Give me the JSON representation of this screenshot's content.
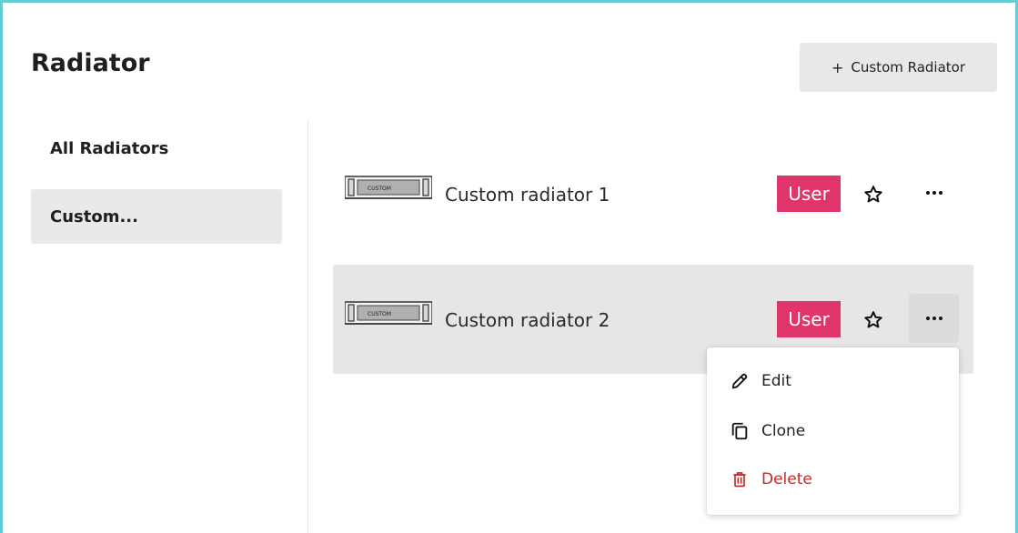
{
  "page": {
    "title": "Radiator"
  },
  "toolbar": {
    "add_icon": "plus-icon",
    "add_label": "Custom Radiator"
  },
  "sidebar": {
    "items": [
      {
        "label": "All Radiators",
        "active": false
      },
      {
        "label": "Custom...",
        "active": true
      }
    ]
  },
  "radiators": [
    {
      "thumb_label": "CUSTOM",
      "name": "Custom radiator 1",
      "badge": "User",
      "star_icon": "star-outline-icon",
      "more_icon": "more-horizontal-icon"
    },
    {
      "thumb_label": "CUSTOM",
      "name": "Custom radiator 2",
      "badge": "User",
      "star_icon": "star-outline-icon",
      "more_icon": "more-horizontal-icon"
    }
  ],
  "context_menu": {
    "items": [
      {
        "label": "Edit",
        "icon": "pencil-icon"
      },
      {
        "label": "Clone",
        "icon": "copy-icon"
      },
      {
        "label": "Delete",
        "icon": "trash-icon"
      }
    ]
  },
  "colors": {
    "accent_border": "#63ccd6",
    "badge": "#e0356a",
    "danger": "#c62828",
    "selected_bg": "#e9e9e9"
  }
}
